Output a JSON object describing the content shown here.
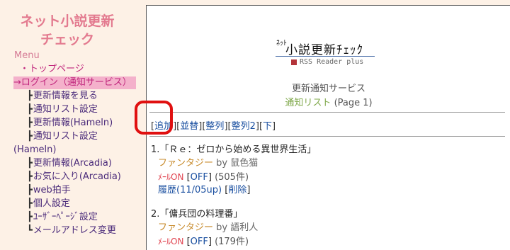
{
  "sidebar": {
    "title_line1": "ネット小説更新",
    "title_line2": "チェック",
    "menu_label": "Menu",
    "items": [
      {
        "label": "・トップページ"
      },
      {
        "label": "→ログイン（通知サービス）"
      },
      {
        "label": "更新情報を見る"
      },
      {
        "label": "通知リスト設定"
      },
      {
        "label": "更新情報(Hameln)"
      },
      {
        "label": "通知リスト設定"
      },
      {
        "label": "(Hameln)"
      },
      {
        "label": "更新情報(Arcadia)"
      },
      {
        "label": "お気に入り(Arcadia)"
      },
      {
        "label": "web拍手"
      },
      {
        "label": "個人設定"
      },
      {
        "label": "ﾕｰｻﾞｰﾍﾟｰｼﾞ設定"
      },
      {
        "label": "メールアドレス変更"
      }
    ]
  },
  "logo": {
    "prefix": "ﾈｯﾄ",
    "name": "小説更新ﾁｪｯｸ",
    "subtitle": "RSS Reader plus"
  },
  "service": {
    "title": "更新通知サービス",
    "list_link": "通知リスト",
    "page": "(Page 1)"
  },
  "toolbar": {
    "add": "追加",
    "reorder": "並替",
    "sort": "整列",
    "sort2": "整列2",
    "down": "下"
  },
  "entries": [
    {
      "title": "1.「Ｒｅ：ゼロから始める異世界生活」",
      "genre": "ファンタジー",
      "by": "by",
      "author": "鼠色猫",
      "mail_on": "ﾒｰﾙON",
      "off": "OFF",
      "count": "(505件)",
      "history": "履歴(11/05up)",
      "delete": "削除"
    },
    {
      "title": "2.「傭兵団の料理番」",
      "genre": "ファンタジー",
      "by": "by",
      "author": "語利人",
      "mail_on": "ﾒｰﾙON",
      "off": "OFF",
      "count": "(179件)"
    }
  ]
}
